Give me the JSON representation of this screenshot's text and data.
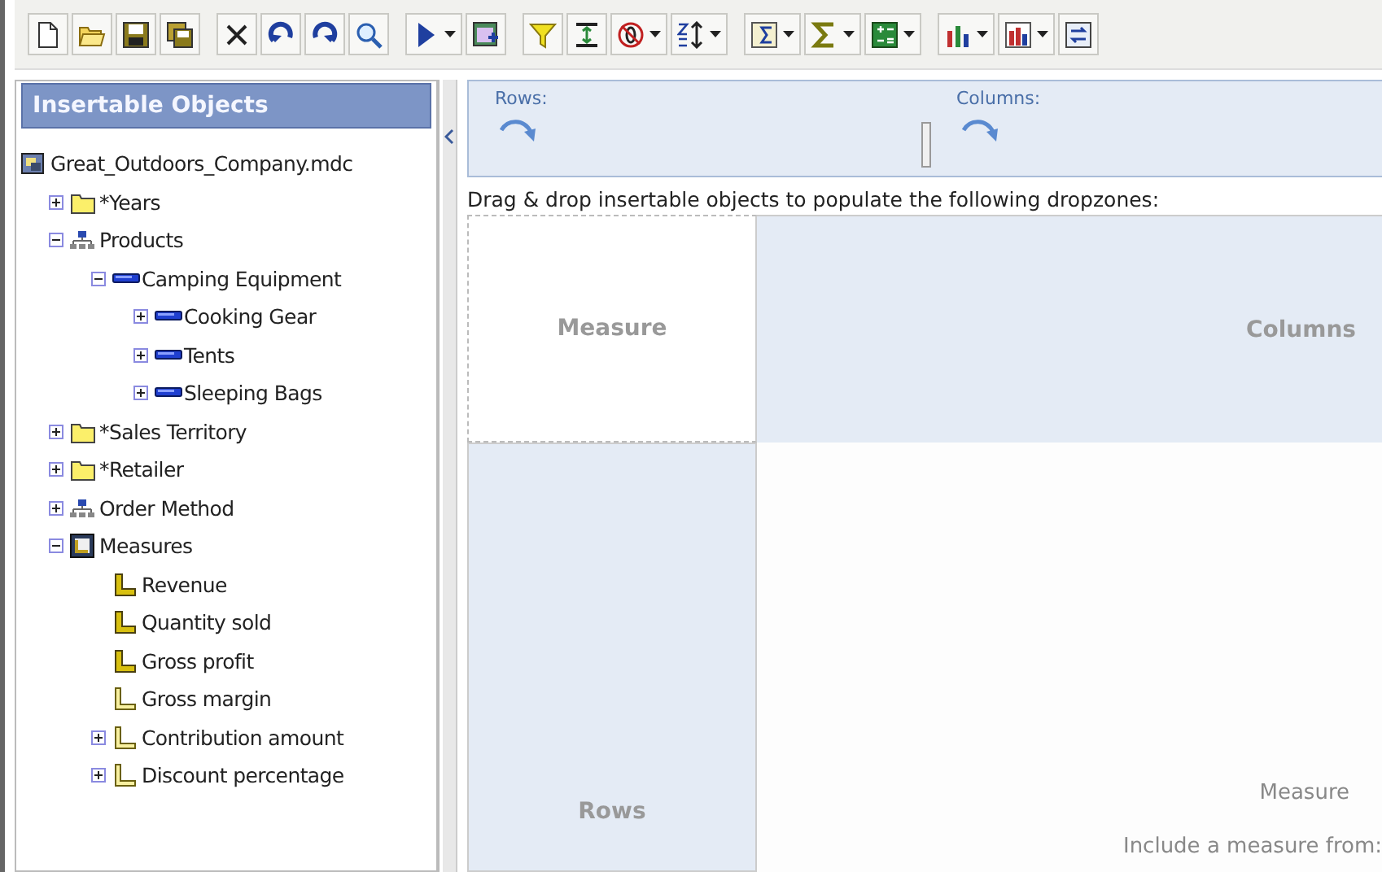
{
  "toolbar": {
    "groups": [
      [
        {
          "kind": "new",
          "dropdown": false
        },
        {
          "kind": "open",
          "dropdown": false
        },
        {
          "kind": "save",
          "dropdown": false
        },
        {
          "kind": "save-all",
          "dropdown": false
        }
      ],
      [
        {
          "kind": "cut",
          "dropdown": false
        },
        {
          "kind": "undo",
          "dropdown": false
        },
        {
          "kind": "redo",
          "dropdown": false
        },
        {
          "kind": "find",
          "dropdown": false
        }
      ],
      [
        {
          "kind": "run",
          "dropdown": true
        },
        {
          "kind": "insert",
          "dropdown": false
        }
      ],
      [
        {
          "kind": "filter",
          "dropdown": false
        },
        {
          "kind": "suppress",
          "dropdown": false
        },
        {
          "kind": "null",
          "dropdown": true
        },
        {
          "kind": "sort",
          "dropdown": true
        }
      ],
      [
        {
          "kind": "summary",
          "dropdown": true
        },
        {
          "kind": "sum",
          "dropdown": true
        },
        {
          "kind": "calc",
          "dropdown": true
        }
      ],
      [
        {
          "kind": "bars",
          "dropdown": true
        },
        {
          "kind": "chart",
          "dropdown": true
        },
        {
          "kind": "swap",
          "dropdown": false
        }
      ]
    ]
  },
  "sidebar": {
    "title": "Insertable Objects",
    "tree": [
      {
        "label": "Great_Outdoors_Company.mdc",
        "kind": "cube",
        "children": [
          {
            "label": "*Years",
            "kind": "folder",
            "expanded": false
          },
          {
            "label": "Products",
            "kind": "hierarchy",
            "expanded": true,
            "children": [
              {
                "label": "Camping Equipment",
                "kind": "level",
                "expanded": true,
                "children": [
                  {
                    "label": "Cooking Gear",
                    "kind": "level",
                    "expanded": false
                  },
                  {
                    "label": "Tents",
                    "kind": "level",
                    "expanded": false
                  },
                  {
                    "label": "Sleeping Bags",
                    "kind": "level",
                    "expanded": false
                  }
                ]
              }
            ]
          },
          {
            "label": "*Sales Territory",
            "kind": "folder",
            "expanded": false
          },
          {
            "label": "*Retailer",
            "kind": "folder",
            "expanded": false
          },
          {
            "label": "Order Method",
            "kind": "hierarchy",
            "expanded": false
          },
          {
            "label": "Measures",
            "kind": "measures",
            "expanded": true,
            "children": [
              {
                "label": "Revenue",
                "kind": "measure"
              },
              {
                "label": "Quantity sold",
                "kind": "measure"
              },
              {
                "label": "Gross profit",
                "kind": "measure"
              },
              {
                "label": "Gross margin",
                "kind": "calculated"
              },
              {
                "label": "Contribution amount",
                "kind": "calculated",
                "expanded": false
              },
              {
                "label": "Discount percentage",
                "kind": "calculated",
                "expanded": false
              }
            ]
          }
        ]
      }
    ]
  },
  "edge_bar": {
    "rows_label": "Rows:",
    "columns_label": "Columns:"
  },
  "instruction": "Drag & drop insertable objects to populate the following dropzones:",
  "dropzones": {
    "corner": "Measure",
    "columns": "Columns",
    "rows": "Rows",
    "body_title": "Measure",
    "body_hint": "Include a measure from:"
  }
}
